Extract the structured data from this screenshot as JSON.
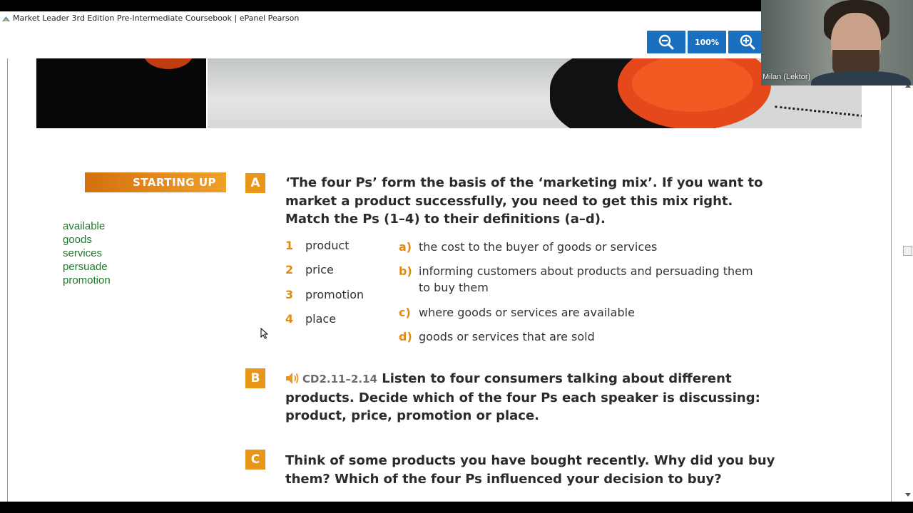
{
  "window": {
    "title": "Market Leader 3rd Edition Pre-Intermediate Coursebook | ePanel Pearson"
  },
  "toolbar": {
    "zoom_level": "100%",
    "zoom_out_icon": "zoom-out-icon",
    "zoom_in_icon": "zoom-in-icon",
    "accent_color": "#1a6fbf"
  },
  "video_call": {
    "participant_name": "Milan (Lektor)"
  },
  "page": {
    "section_heading": "STARTING UP",
    "word_list": [
      "available",
      "goods",
      "services",
      "persuade",
      "promotion"
    ],
    "exercise_a": {
      "letter": "A",
      "instruction": "‘The four Ps’ form the basis of the ‘marketing mix’. If you want to market a product successfully, you need to get this mix right. Match the Ps (1–4) to their definitions (a–d).",
      "items": [
        {
          "num": "1",
          "text": "product"
        },
        {
          "num": "2",
          "text": "price"
        },
        {
          "num": "3",
          "text": "promotion"
        },
        {
          "num": "4",
          "text": "place"
        }
      ],
      "definitions": [
        {
          "letter": "a)",
          "text": "the cost to the buyer of goods or services"
        },
        {
          "letter": "b)",
          "text": "informing customers about products and persuading them to buy them"
        },
        {
          "letter": "c)",
          "text": "where goods or services are available"
        },
        {
          "letter": "d)",
          "text": "goods or services that are sold"
        }
      ]
    },
    "exercise_b": {
      "letter": "B",
      "cd_ref": "CD2.11–2.14",
      "instruction": "Listen to four consumers talking about different products. Decide which of the four Ps each speaker is discussing: product, price, promotion or place."
    },
    "exercise_c": {
      "letter": "C",
      "instruction": "Think of some products you have bought recently. Why did you buy them? Which of the four Ps influenced your decision to buy?"
    },
    "accent_color": "#e8961a",
    "word_list_color": "#1a7a2a"
  }
}
